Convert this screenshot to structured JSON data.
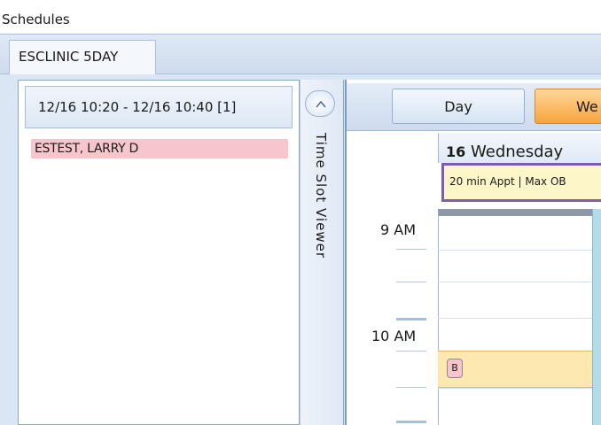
{
  "window": {
    "title": "Schedules"
  },
  "tabs": [
    {
      "label": "ESCLINIC 5DAY",
      "active": true
    }
  ],
  "time_slot_list": {
    "header": "12/16 10:20 - 12/16 10:40  [1]",
    "rows": [
      {
        "patient": "ESTEST, LARRY D",
        "color": "#f7c6cd"
      }
    ]
  },
  "viewer": {
    "label": "Time Slot Viewer",
    "toggle_icon": "circle-chevron-icon"
  },
  "calendar": {
    "view_buttons": {
      "day": "Day",
      "week": "We"
    },
    "active_view": "week",
    "times": [
      "9 AM",
      "10 AM"
    ],
    "day_header": {
      "date": "16",
      "weekday": "Wednesday"
    },
    "slot_type": "20 min Appt | Max OB",
    "appointment": {
      "chip": "B",
      "color": "#fde8b0"
    },
    "colors": {
      "accent": "#f7a43c",
      "slot_border": "#7e5db0",
      "patient_highlight": "#f7c6cd"
    }
  }
}
